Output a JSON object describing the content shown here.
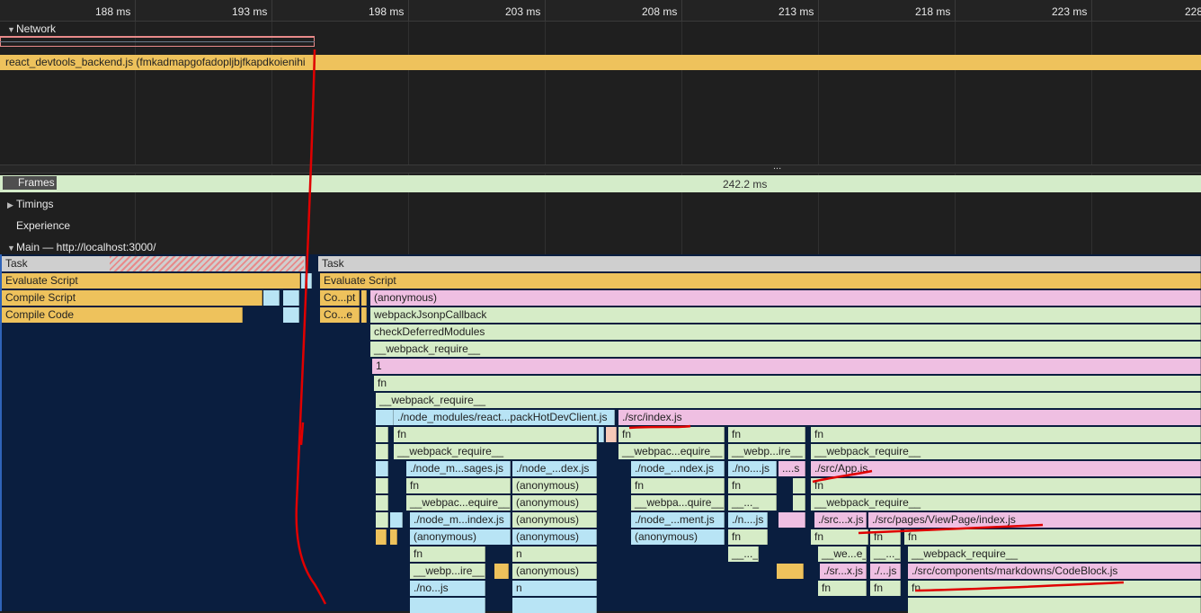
{
  "ruler": {
    "ticks": [
      "188 ms",
      "193 ms",
      "198 ms",
      "203 ms",
      "208 ms",
      "213 ms",
      "218 ms",
      "223 ms",
      "228"
    ]
  },
  "tracks": {
    "network": "Network",
    "network_request": "react_devtools_backend.js (fmkadmapgofadopljbjfkapdkoienihi",
    "frames": "Frames",
    "frames_duration": "242.2 ms",
    "timings": "Timings",
    "experience": "Experience",
    "main": "Main — http://localhost:3000/",
    "resize_handle": "..."
  },
  "colors": {
    "script": "#eec25c",
    "pink": "#efbfe2",
    "green": "#d6ecc7",
    "cyan": "#b8e4f5",
    "task": "#cfcfcf",
    "annotation": "#e00000"
  },
  "flame": {
    "task1": "Task",
    "task2": "Task",
    "evaluate1": "Evaluate Script",
    "evaluate2": "Evaluate Script",
    "compile_script": "Compile Script",
    "compile_code": "Compile Code",
    "copt": "Co...pt",
    "coe": "Co...e",
    "anonymous": "(anonymous)",
    "webpackJsonp": "webpackJsonpCallback",
    "checkDeferred": "checkDeferredModules",
    "webpack_require": "__webpack_require__",
    "one": "1",
    "fn": "fn",
    "n": "n",
    "hotDevClient": "./node_modules/react...packHotDevClient.js",
    "src_index": "./src/index.js",
    "webpac_equire": "__webpac...equire__",
    "webp_ire": "__webp...ire__",
    "node_m_sages": "./node_m...sages.js",
    "node_dex": "./node_...dex.js",
    "node_ndex": "./node_...ndex.js",
    "no_js": "./no....js",
    "dots_s": "....s",
    "src_app": "./src/App.js",
    "webpac_equire2": "__webpac...equire__",
    "webpa_quire": "__webpa...quire__",
    "dots_underscore": "__..._",
    "node_m_index": "./node_m...index.js",
    "node_ment": "./node_...ment.js",
    "n_js": "./n....js",
    "src_x": "./src...x.js",
    "viewpage": "./src/pages/ViewPage/index.js",
    "we_e": "__we...e__",
    "dash2": "__..._",
    "webp_ire2": "__webp...ire__",
    "sr_x": "./sr...x.js",
    "dots_js": "./...js",
    "codeblock": "./src/components/markdowns/CodeBlock.js",
    "no_js2": "./no...js"
  }
}
